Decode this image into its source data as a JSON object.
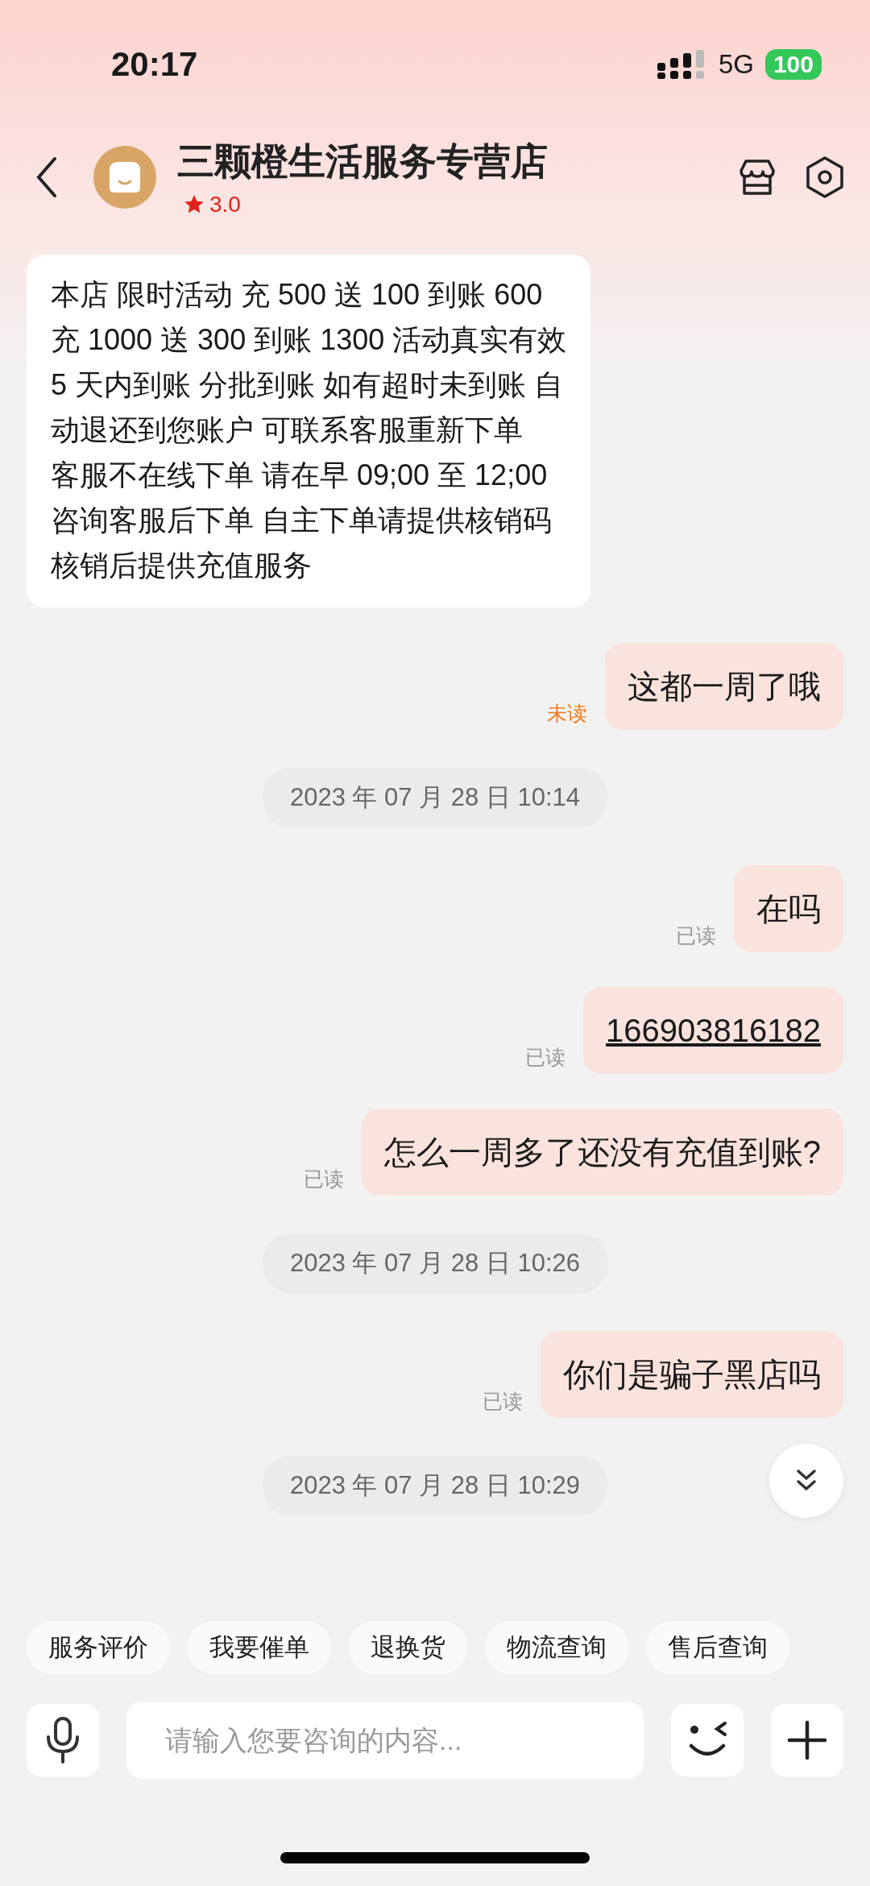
{
  "status_bar": {
    "time": "20:17",
    "network": "5G",
    "battery": "100"
  },
  "header": {
    "shop_name": "三颗橙生活服务专营店",
    "rating": "3.0"
  },
  "messages": [
    {
      "kind": "shop",
      "lines": [
        "本店 限时活动 充 500 送 100 到账 600",
        "充 1000 送 300 到账 1300 活动真实有效",
        "5 天内到账 分批到账 如有超时未到账 自",
        "动退还到您账户 可联系客服重新下单",
        "客服不在线下单 请在早 09;00 至 12;00",
        "咨询客服后下单 自主下单请提供核销码",
        "核销后提供充值服务"
      ]
    },
    {
      "kind": "mine",
      "text": "这都一周了哦",
      "status": "未读",
      "read": false,
      "underlined": false
    },
    {
      "kind": "time",
      "text": "2023 年 07 月 28 日  10:14"
    },
    {
      "kind": "mine",
      "text": "在吗",
      "status": "已读",
      "read": true,
      "underlined": false
    },
    {
      "kind": "mine",
      "text": "166903816182",
      "status": "已读",
      "read": true,
      "underlined": true
    },
    {
      "kind": "mine",
      "text": "怎么一周多了还没有充值到账?",
      "status": "已读",
      "read": true,
      "underlined": false
    },
    {
      "kind": "time",
      "text": "2023 年 07 月 28 日  10:26"
    },
    {
      "kind": "mine",
      "text": "你们是骗子黑店吗",
      "status": "已读",
      "read": true,
      "underlined": false
    },
    {
      "kind": "time",
      "text": "2023 年 07 月 28 日  10:29"
    }
  ],
  "quick_actions": [
    "服务评价",
    "我要催单",
    "退换货",
    "物流查询",
    "售后查询"
  ],
  "input": {
    "placeholder": "请输入您要咨询的内容..."
  }
}
